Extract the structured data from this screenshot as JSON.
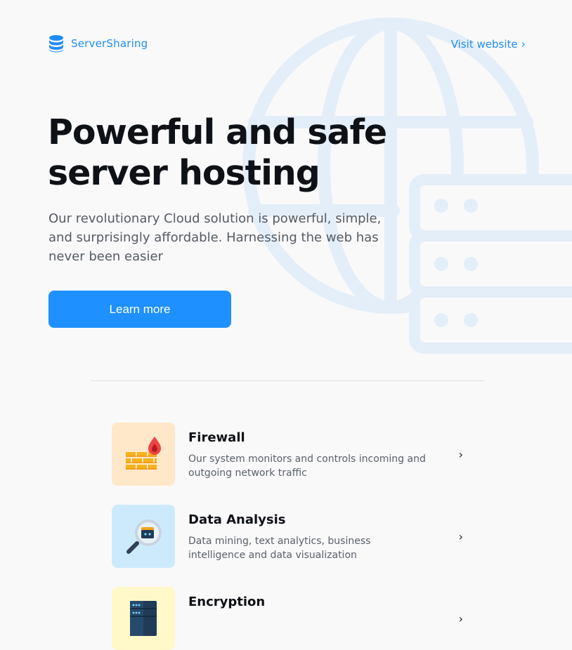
{
  "header": {
    "brand_name": "ServerSharing",
    "visit_label": "Visit website",
    "visit_chevron": "›"
  },
  "hero": {
    "title": "Powerful and safe server hosting",
    "description": "Our revolutionary Cloud solution is powerful, simple, and surprisingly affordable. Harnessing the web has never been easier",
    "cta_label": "Learn more"
  },
  "features": [
    {
      "title": "Firewall",
      "description": "Our system monitors and controls incoming and outgoing network traffic",
      "icon": "firewall-icon",
      "tile_color": "#ffe8c9",
      "chevron": "›"
    },
    {
      "title": "Data Analysis",
      "description": "Data mining, text analytics, business intelligence and data visualization",
      "icon": "magnifier-icon",
      "tile_color": "#cdeafd",
      "chevron": "›"
    },
    {
      "title": "Encryption",
      "description": "",
      "icon": "server-rack-icon",
      "tile_color": "#fff9c9",
      "chevron": "›"
    }
  ],
  "colors": {
    "accent": "#1e8df5",
    "button": "#1e90ff",
    "background": "#f9f9fa",
    "decor": "#e6f0fa"
  }
}
